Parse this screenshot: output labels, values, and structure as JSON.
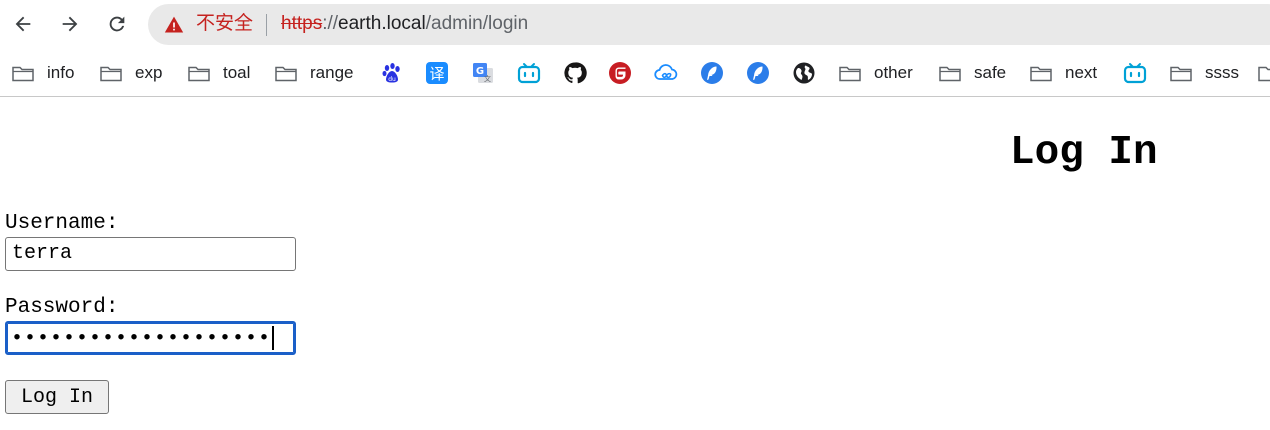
{
  "toolbar": {
    "security_label": "不安全",
    "url": {
      "scheme": "https",
      "separator": "://",
      "host": "earth.local",
      "path": "/admin/login"
    },
    "colors": {
      "warning": "#c5221f",
      "omnibox_bg": "#e9e9e9"
    }
  },
  "bookmarks": [
    {
      "type": "folder",
      "label": "info"
    },
    {
      "type": "folder",
      "label": "exp"
    },
    {
      "type": "folder",
      "label": "toal"
    },
    {
      "type": "folder",
      "label": "range"
    },
    {
      "type": "site",
      "icon": "baidu-paw-icon"
    },
    {
      "type": "site",
      "icon": "translate-yi-icon"
    },
    {
      "type": "site",
      "icon": "google-translate-icon"
    },
    {
      "type": "site",
      "icon": "bilibili-tv-icon"
    },
    {
      "type": "site",
      "icon": "github-icon"
    },
    {
      "type": "site",
      "icon": "gitee-icon"
    },
    {
      "type": "site",
      "icon": "cloud-infinity-icon"
    },
    {
      "type": "site",
      "icon": "feather-blue-icon"
    },
    {
      "type": "site",
      "icon": "feather-blue-icon"
    },
    {
      "type": "site",
      "icon": "globe-icon"
    },
    {
      "type": "folder",
      "label": "other"
    },
    {
      "type": "folder",
      "label": "safe"
    },
    {
      "type": "folder",
      "label": "next"
    },
    {
      "type": "site",
      "icon": "bilibili-tv-icon"
    },
    {
      "type": "folder",
      "label": "ssss"
    }
  ],
  "form": {
    "title": "Log In",
    "username_label": "Username:",
    "username_value": "terra",
    "password_label": "Password:",
    "password_masked": "••••••••••••••••••••",
    "submit_label": "Log In"
  }
}
